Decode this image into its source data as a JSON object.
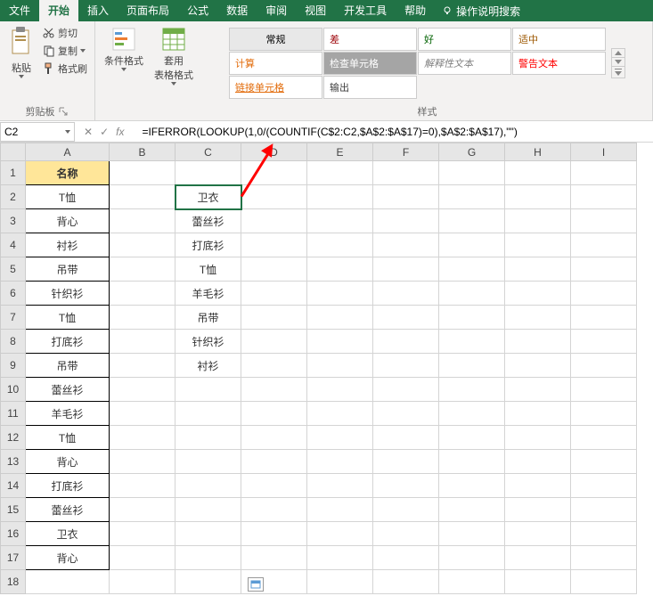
{
  "menu": {
    "file": "文件",
    "home": "开始",
    "insert": "插入",
    "layout": "页面布局",
    "formulas": "公式",
    "data": "数据",
    "review": "审阅",
    "view": "视图",
    "dev": "开发工具",
    "help": "帮助",
    "tellme": "操作说明搜索"
  },
  "ribbon": {
    "paste": "粘贴",
    "cut": "剪切",
    "copy": "复制",
    "format_painter": "格式刷",
    "clipboard": "剪贴板",
    "cond_format": "条件格式",
    "table_format": "套用\n表格格式",
    "normal": "常规",
    "bad": "差",
    "good": "好",
    "neutral": "适中",
    "calc": "计算",
    "check": "检查单元格",
    "explain": "解释性文本",
    "warn": "警告文本",
    "link": "链接单元格",
    "output": "输出",
    "styles_label": "样式"
  },
  "namebox": "C2",
  "formula": "=IFERROR(LOOKUP(1,0/(COUNTIF(C$2:C2,$A$2:$A$17)=0),$A$2:$A$17),\"\")",
  "columns": [
    "A",
    "B",
    "C",
    "D",
    "E",
    "F",
    "G",
    "H",
    "I"
  ],
  "rows": [
    "1",
    "2",
    "3",
    "4",
    "5",
    "6",
    "7",
    "8",
    "9",
    "10",
    "11",
    "12",
    "13",
    "14",
    "15",
    "16",
    "17",
    "18"
  ],
  "cells": {
    "A1": "名称",
    "A2": "T恤",
    "A3": "背心",
    "A4": "衬衫",
    "A5": "吊带",
    "A6": "针织衫",
    "A7": "T恤",
    "A8": "打底衫",
    "A9": "吊带",
    "A10": "蕾丝衫",
    "A11": "羊毛衫",
    "A12": "T恤",
    "A13": "背心",
    "A14": "打底衫",
    "A15": "蕾丝衫",
    "A16": "卫衣",
    "A17": "背心",
    "C2": "卫衣",
    "C3": "蕾丝衫",
    "C4": "打底衫",
    "C5": "T恤",
    "C6": "羊毛衫",
    "C7": "吊带",
    "C8": "针织衫",
    "C9": "衬衫"
  }
}
